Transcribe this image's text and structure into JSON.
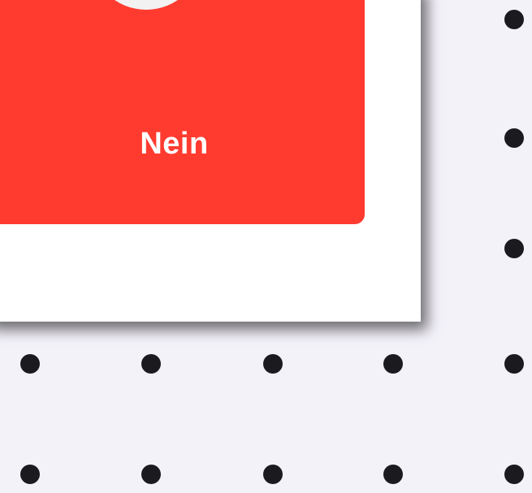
{
  "dialog": {
    "no_label": "Nein"
  },
  "colors": {
    "background": "#f4f2f9",
    "dot": "#1b1b1f",
    "card": "#ffffff",
    "no_button": "#ff3b30",
    "circle": "#f2f2f2"
  },
  "icons": {
    "button_circle": "circle-icon"
  }
}
